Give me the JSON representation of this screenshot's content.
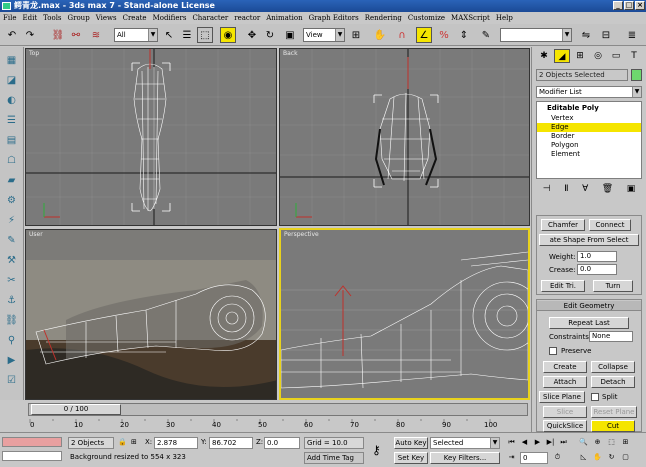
{
  "window": {
    "title": "鳄青龙.max - 3ds max 7 - Stand-alone License"
  },
  "menu": [
    "File",
    "Edit",
    "Tools",
    "Group",
    "Views",
    "Create",
    "Modifiers",
    "Character",
    "reactor",
    "Animation",
    "Graph Editors",
    "Rendering",
    "Customize",
    "MAXScript",
    "Help"
  ],
  "toolbar": {
    "selection_filter": "All",
    "ref_coord": "View"
  },
  "viewports": {
    "top": "Top",
    "back": "Back",
    "user": "User",
    "perspective": "Perspective"
  },
  "command_panel": {
    "object_name": "2 Objects Selected",
    "modifier_list": "Modifier List",
    "stack": {
      "base": "Editable Poly",
      "items": [
        "Vertex",
        "Edge",
        "Border",
        "Polygon",
        "Element"
      ],
      "selected": "Edge"
    },
    "edit_edges": {
      "chamfer": "Chamfer",
      "connect": "Connect",
      "create_shape": "ate Shape From Select",
      "weight_label": "Weight:",
      "weight_value": "1.0",
      "crease_label": "Crease:",
      "crease_value": "0.0",
      "edit_tri": "Edit Tri.",
      "turn": "Turn"
    },
    "edit_geometry": {
      "title": "Edit Geometry",
      "repeat_last": "Repeat Last",
      "constraints_label": "Constraints:",
      "constraints_value": "None",
      "preserve": "Preserve",
      "create": "Create",
      "collapse": "Collapse",
      "attach": "Attach",
      "detach": "Detach",
      "slice_plane": "Slice Plane",
      "split": "Split",
      "slice": "Slice",
      "reset_plane": "Reset Plane",
      "quickslice": "QuickSlice",
      "cut": "Cut"
    }
  },
  "timeline": {
    "slider": "0 / 100",
    "ticks": [
      "0",
      "10",
      "20",
      "30",
      "40",
      "50",
      "60",
      "70",
      "80",
      "90",
      "100"
    ]
  },
  "status": {
    "selection": "2 Objects",
    "x_label": "X:",
    "x": "2.878",
    "y_label": "Y:",
    "y": "86.702",
    "z_label": "Z:",
    "z": "0.0",
    "grid": "Grid = 10.0",
    "prompt": "Background resized to 554 x 323",
    "add_time_tag": "Add Time Tag",
    "auto_key": "Auto Key",
    "set_key": "Set Key",
    "key_mode": "Selected",
    "key_filters": "Key Filters...",
    "frame": "0"
  }
}
